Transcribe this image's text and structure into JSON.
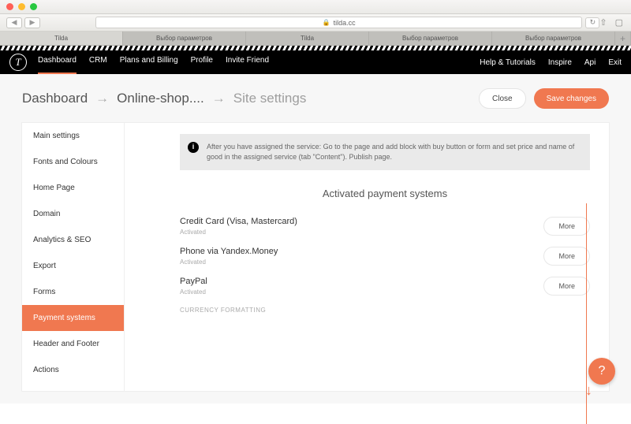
{
  "browser": {
    "url_host": "tilda.cc",
    "tabs": [
      "Tilda",
      "Выбор параметров",
      "Tilda",
      "Выбор параметров",
      "Выбор параметров"
    ],
    "active_tab_index": 0
  },
  "appnav": {
    "left": [
      "Dashboard",
      "CRM",
      "Plans and Billing",
      "Profile",
      "Invite Friend"
    ],
    "active_left_index": 0,
    "right": [
      "Help & Tutorials",
      "Inspire",
      "Api",
      "Exit"
    ]
  },
  "breadcrumb": {
    "a": "Dashboard",
    "b": "Online-shop....",
    "c": "Site settings"
  },
  "buttons": {
    "close": "Close",
    "save": "Save changes",
    "more": "More"
  },
  "sidebar": {
    "items": [
      "Main settings",
      "Fonts and Colours",
      "Home Page",
      "Domain",
      "Analytics & SEO",
      "Export",
      "Forms",
      "Payment systems",
      "Header and Footer",
      "Actions"
    ],
    "selected_index": 7
  },
  "notice": "After you have assigned the service: Go to the page and add block with buy button or form and set price and name of good in the assigned service (tab \"Content\"). Publish page.",
  "section_title": "Activated payment systems",
  "payments": [
    {
      "name": "Credit Card (Visa, Mastercard)",
      "status": "Activated"
    },
    {
      "name": "Phone via Yandex.Money",
      "status": "Activated"
    },
    {
      "name": "PayPal",
      "status": "Activated"
    }
  ],
  "sub_header": "CURRENCY FORMATTING",
  "help_label": "?"
}
